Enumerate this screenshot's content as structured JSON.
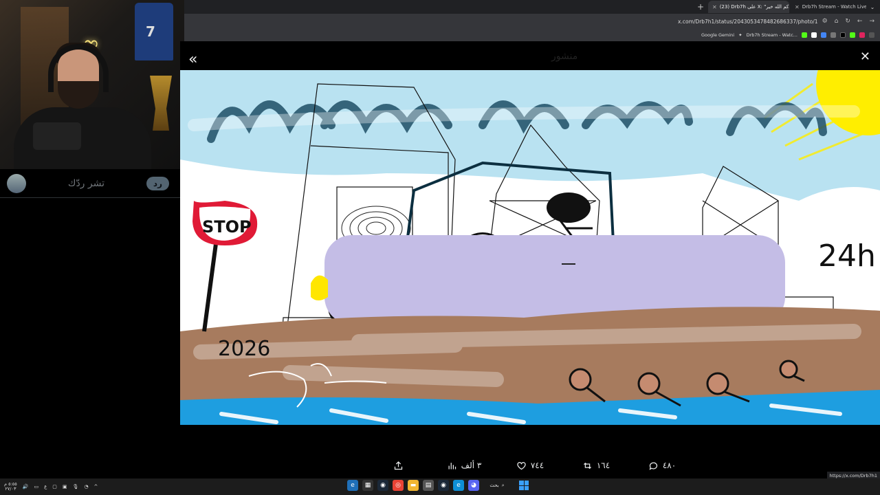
{
  "browser": {
    "tabs": [
      {
        "title": "(23) Drb7h على X: \"دكم الله خير\"",
        "active": true
      },
      {
        "title": "Drb7h Stream - Watch Live on Kick",
        "active": false
      }
    ],
    "new_tab_symbol": "+",
    "url": "x.com/Drb7h1/status/2043053478482686337/photo/1",
    "bookmarks": [
      "Google Gemini",
      "Drb7h Stream - Watc..."
    ],
    "hover_url": "https://x.com/Drb7h1"
  },
  "reply_box": {
    "placeholder": "تشر ردّك",
    "button_label": "رد"
  },
  "viewer": {
    "ghost_title": "منشور",
    "drawing_texts": {
      "stop_sign": "STOP",
      "year": "2026",
      "hours": "24h"
    },
    "actions": {
      "views": "٣ ألف",
      "likes": "٧٤٤",
      "reposts": "١٦٤",
      "replies": "٤٨٠"
    }
  },
  "webcam": {
    "jersey_number": "7"
  },
  "taskbar": {
    "search_label": "بحث",
    "clock_time": "٥:٥٥ م",
    "clock_date": "٢٧/٠٣",
    "lang": "ع"
  },
  "colors": {
    "sky": "#b9e2f1",
    "ground": "#a77b5e",
    "water": "#1e9ee0",
    "car_body": "#c4bde6",
    "sun": "#ffee00",
    "stop_red": "#e01a36"
  },
  "icons": [
    "chevrons-left-icon",
    "close-icon",
    "share-icon",
    "views-icon",
    "heart-icon",
    "repost-icon",
    "reply-icon",
    "search-icon",
    "start-icon"
  ]
}
